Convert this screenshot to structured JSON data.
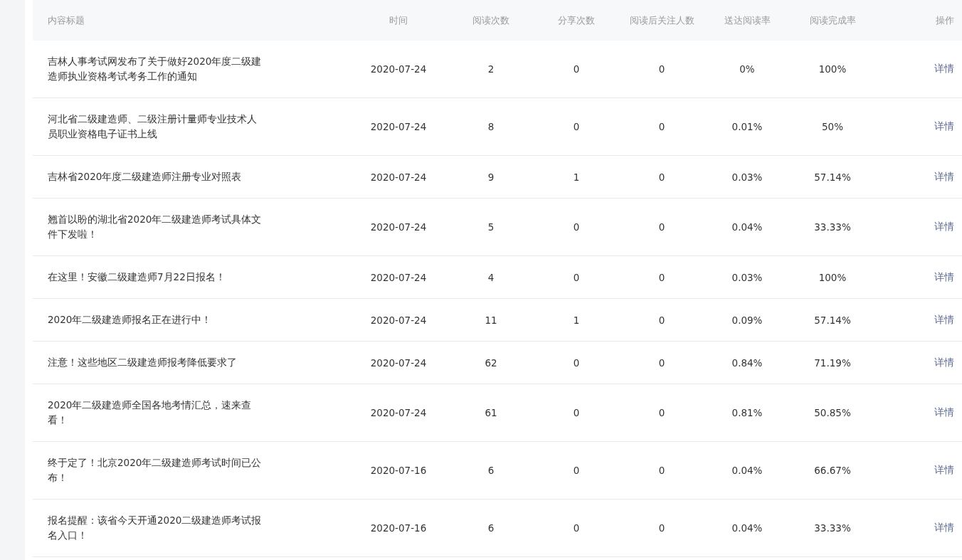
{
  "table": {
    "columns": [
      "内容标题",
      "时间",
      "阅读次数",
      "分享次数",
      "阅读后关注人数",
      "送达阅读率",
      "阅读完成率",
      "操作"
    ],
    "rows": [
      {
        "title": "吉林人事考试网发布了关于做好2020年度二级建造师执业资格考试考务工作的通知",
        "time": "2020-07-24",
        "reads": "2",
        "shares": "0",
        "follows": "0",
        "delivered_read_rate": "0%",
        "completion_rate": "100%",
        "action": "详情"
      },
      {
        "title": "河北省二级建造师、二级注册计量师专业技术人员职业资格电子证书上线",
        "time": "2020-07-24",
        "reads": "8",
        "shares": "0",
        "follows": "0",
        "delivered_read_rate": "0.01%",
        "completion_rate": "50%",
        "action": "详情"
      },
      {
        "title": "吉林省2020年度二级建造师注册专业对照表",
        "time": "2020-07-24",
        "reads": "9",
        "shares": "1",
        "follows": "0",
        "delivered_read_rate": "0.03%",
        "completion_rate": "57.14%",
        "action": "详情"
      },
      {
        "title": "翘首以盼的湖北省2020年二级建造师考试具体文件下发啦！",
        "time": "2020-07-24",
        "reads": "5",
        "shares": "0",
        "follows": "0",
        "delivered_read_rate": "0.04%",
        "completion_rate": "33.33%",
        "action": "详情"
      },
      {
        "title": "在这里！安徽二级建造师7月22日报名！",
        "time": "2020-07-24",
        "reads": "4",
        "shares": "0",
        "follows": "0",
        "delivered_read_rate": "0.03%",
        "completion_rate": "100%",
        "action": "详情"
      },
      {
        "title": "2020年二级建造师报名正在进行中！",
        "time": "2020-07-24",
        "reads": "11",
        "shares": "1",
        "follows": "0",
        "delivered_read_rate": "0.09%",
        "completion_rate": "57.14%",
        "action": "详情"
      },
      {
        "title": "注意！这些地区二级建造师报考降低要求了",
        "time": "2020-07-24",
        "reads": "62",
        "shares": "0",
        "follows": "0",
        "delivered_read_rate": "0.84%",
        "completion_rate": "71.19%",
        "action": "详情"
      },
      {
        "title": "2020年二级建造师全国各地考情汇总，速来查看！",
        "time": "2020-07-24",
        "reads": "61",
        "shares": "0",
        "follows": "0",
        "delivered_read_rate": "0.81%",
        "completion_rate": "50.85%",
        "action": "详情"
      },
      {
        "title": "终于定了！北京2020年二级建造师考试时间已公布！",
        "time": "2020-07-16",
        "reads": "6",
        "shares": "0",
        "follows": "0",
        "delivered_read_rate": "0.04%",
        "completion_rate": "66.67%",
        "action": "详情"
      },
      {
        "title": "报名提醒：该省今天开通2020二级建造师考试报名入口！",
        "time": "2020-07-16",
        "reads": "6",
        "shares": "0",
        "follows": "0",
        "delivered_read_rate": "0.04%",
        "completion_rate": "33.33%",
        "action": "详情"
      }
    ]
  }
}
